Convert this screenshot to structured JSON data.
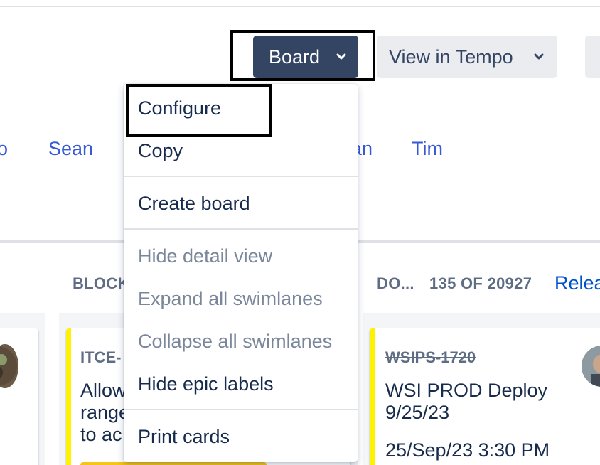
{
  "header": {
    "board_button": {
      "label": "Board",
      "icon": "chevron-down-icon"
    },
    "tempo_button": {
      "label": "View in Tempo",
      "icon": "chevron-down-icon"
    }
  },
  "quick_filters": [
    "o",
    "Sean",
    "an",
    "Tim"
  ],
  "columns": {
    "blocked_header": "BLOCK",
    "done_header": "DO...",
    "done_count": "135 OF 20927",
    "release_link": "Relea"
  },
  "cards": [
    {
      "key": "ITCE-",
      "summary_lines": [
        "Allow",
        "range",
        "to ac"
      ],
      "avatar": "avatar-icon"
    },
    {
      "key": "WSIPS-1720",
      "summary_lines": [
        "WSI PROD Deploy",
        "9/25/23"
      ],
      "extra": "25/Sep/23 3:30 PM",
      "status": "done",
      "avatar": "avatar-icon"
    }
  ],
  "board_menu": {
    "items": [
      {
        "label": "Configure",
        "enabled": true
      },
      {
        "label": "Copy",
        "enabled": true
      },
      {
        "label": "Create board",
        "enabled": true
      },
      {
        "label": "Hide detail view",
        "enabled": false
      },
      {
        "label": "Expand all swimlanes",
        "enabled": false
      },
      {
        "label": "Collapse all swimlanes",
        "enabled": false
      },
      {
        "label": "Hide epic labels",
        "enabled": true
      },
      {
        "label": "Print cards",
        "enabled": true
      }
    ]
  },
  "colors": {
    "board_button_bg": "#344563",
    "neutral_button_bg": "#ebecf0",
    "link_blue": "#3858d6",
    "release_blue": "#0052cc",
    "card_accent": "#fff200",
    "disabled_text": "#7a869a"
  }
}
